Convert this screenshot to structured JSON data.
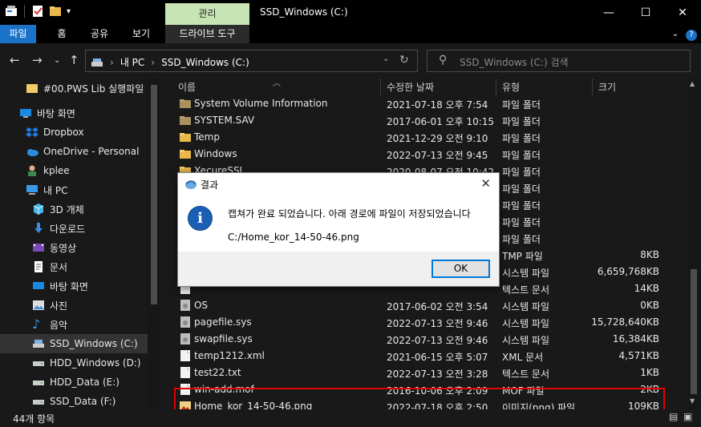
{
  "window": {
    "title": "SSD_Windows (C:)",
    "manage_tab": "관리",
    "drive_tools_tab": "드라이브 도구"
  },
  "ribbon": {
    "tabs": [
      "파일",
      "홈",
      "공유",
      "보기"
    ]
  },
  "address": {
    "crumbs": [
      "내 PC",
      "SSD_Windows (C:)"
    ],
    "search_placeholder": "SSD_Windows (C:) 검색"
  },
  "nav": {
    "items": [
      {
        "label": "#00.PWS Lib 실행파일",
        "icon": "folder-icon"
      },
      {
        "label": "바탕 화면",
        "icon": "desktop-icon"
      },
      {
        "label": "Dropbox",
        "icon": "dropbox-icon"
      },
      {
        "label": "OneDrive - Personal",
        "icon": "onedrive-icon"
      },
      {
        "label": "kplee",
        "icon": "user-icon"
      },
      {
        "label": "내 PC",
        "icon": "pc-icon"
      },
      {
        "label": "3D 개체",
        "icon": "cube-icon"
      },
      {
        "label": "다운로드",
        "icon": "download-icon"
      },
      {
        "label": "동영상",
        "icon": "video-icon"
      },
      {
        "label": "문서",
        "icon": "document-icon"
      },
      {
        "label": "바탕 화면",
        "icon": "desktop-icon"
      },
      {
        "label": "사진",
        "icon": "picture-icon"
      },
      {
        "label": "음악",
        "icon": "music-icon"
      },
      {
        "label": "SSD_Windows (C:)",
        "icon": "drive-icon"
      },
      {
        "label": "HDD_Windows (D:)",
        "icon": "drive-icon"
      },
      {
        "label": "HDD_Data (E:)",
        "icon": "drive-icon"
      },
      {
        "label": "SSD_Data (F:)",
        "icon": "drive-icon"
      }
    ]
  },
  "columns": [
    "이름",
    "수정한 날짜",
    "유형",
    "크기"
  ],
  "files": [
    {
      "name": "System Volume Information",
      "date": "2021-07-18 오후 7:54",
      "type": "파일 폴더",
      "size": "",
      "icon": "folder-gray"
    },
    {
      "name": "SYSTEM.SAV",
      "date": "2017-06-01 오후 10:15",
      "type": "파일 폴더",
      "size": "",
      "icon": "folder-gray"
    },
    {
      "name": "Temp",
      "date": "2021-12-29 오전 9:10",
      "type": "파일 폴더",
      "size": "",
      "icon": "folder"
    },
    {
      "name": "Windows",
      "date": "2022-07-13 오전 9:45",
      "type": "파일 폴더",
      "size": "",
      "icon": "folder"
    },
    {
      "name": "XecureSSL",
      "date": "2020-08-07 오전 10:42",
      "type": "파일 폴더",
      "size": "",
      "icon": "folder"
    },
    {
      "name": "",
      "date": "",
      "type": "파일 폴더",
      "size": "",
      "icon": "folder"
    },
    {
      "name": "",
      "date": "",
      "type": "파일 폴더",
      "size": "",
      "icon": "folder"
    },
    {
      "name": "",
      "date": "",
      "type": "파일 폴더",
      "size": "",
      "icon": "folder"
    },
    {
      "name": "",
      "date": "",
      "type": "파일 폴더",
      "size": "",
      "icon": "folder"
    },
    {
      "name": "",
      "date": "",
      "type": "TMP 파일",
      "size": "8KB",
      "icon": "file"
    },
    {
      "name": "",
      "date": "",
      "type": "시스템 파일",
      "size": "6,659,768KB",
      "icon": "file"
    },
    {
      "name": "",
      "date": "",
      "type": "텍스트 문서",
      "size": "14KB",
      "icon": "file"
    },
    {
      "name": "OS",
      "date": "2017-06-02 오전 3:54",
      "type": "시스템 파일",
      "size": "0KB",
      "icon": "file-gray"
    },
    {
      "name": "pagefile.sys",
      "date": "2022-07-13 오전 9:46",
      "type": "시스템 파일",
      "size": "15,728,640KB",
      "icon": "file-gray"
    },
    {
      "name": "swapfile.sys",
      "date": "2022-07-13 오전 9:46",
      "type": "시스템 파일",
      "size": "16,384KB",
      "icon": "file-gray"
    },
    {
      "name": "temp1212.xml",
      "date": "2021-06-15 오후 5:07",
      "type": "XML 문서",
      "size": "4,571KB",
      "icon": "file"
    },
    {
      "name": "test22.txt",
      "date": "2022-07-13 오전 3:28",
      "type": "텍스트 문서",
      "size": "1KB",
      "icon": "file"
    },
    {
      "name": "win-add.mof",
      "date": "2016-10-06 오후 2:09",
      "type": "MOF 파일",
      "size": "2KB",
      "icon": "file"
    },
    {
      "name": "Home_kor_14-50-46.png",
      "date": "2022-07-18 오후 2:50",
      "type": "이미지(png) 파일",
      "size": "109KB",
      "icon": "image"
    }
  ],
  "status": {
    "count": "44개 항목"
  },
  "dialog": {
    "title": "결과",
    "message": "캡쳐가 완료 되었습니다. 아래 경로에 파일이 저장되었습니다",
    "path": "C:/Home_kor_14-50-46.png",
    "ok_label": "OK"
  },
  "colors": {
    "accent": "#1a73c8",
    "manage_tab": "#c7e5b4",
    "highlight": "#e00000",
    "folder": "#e8b84a"
  }
}
